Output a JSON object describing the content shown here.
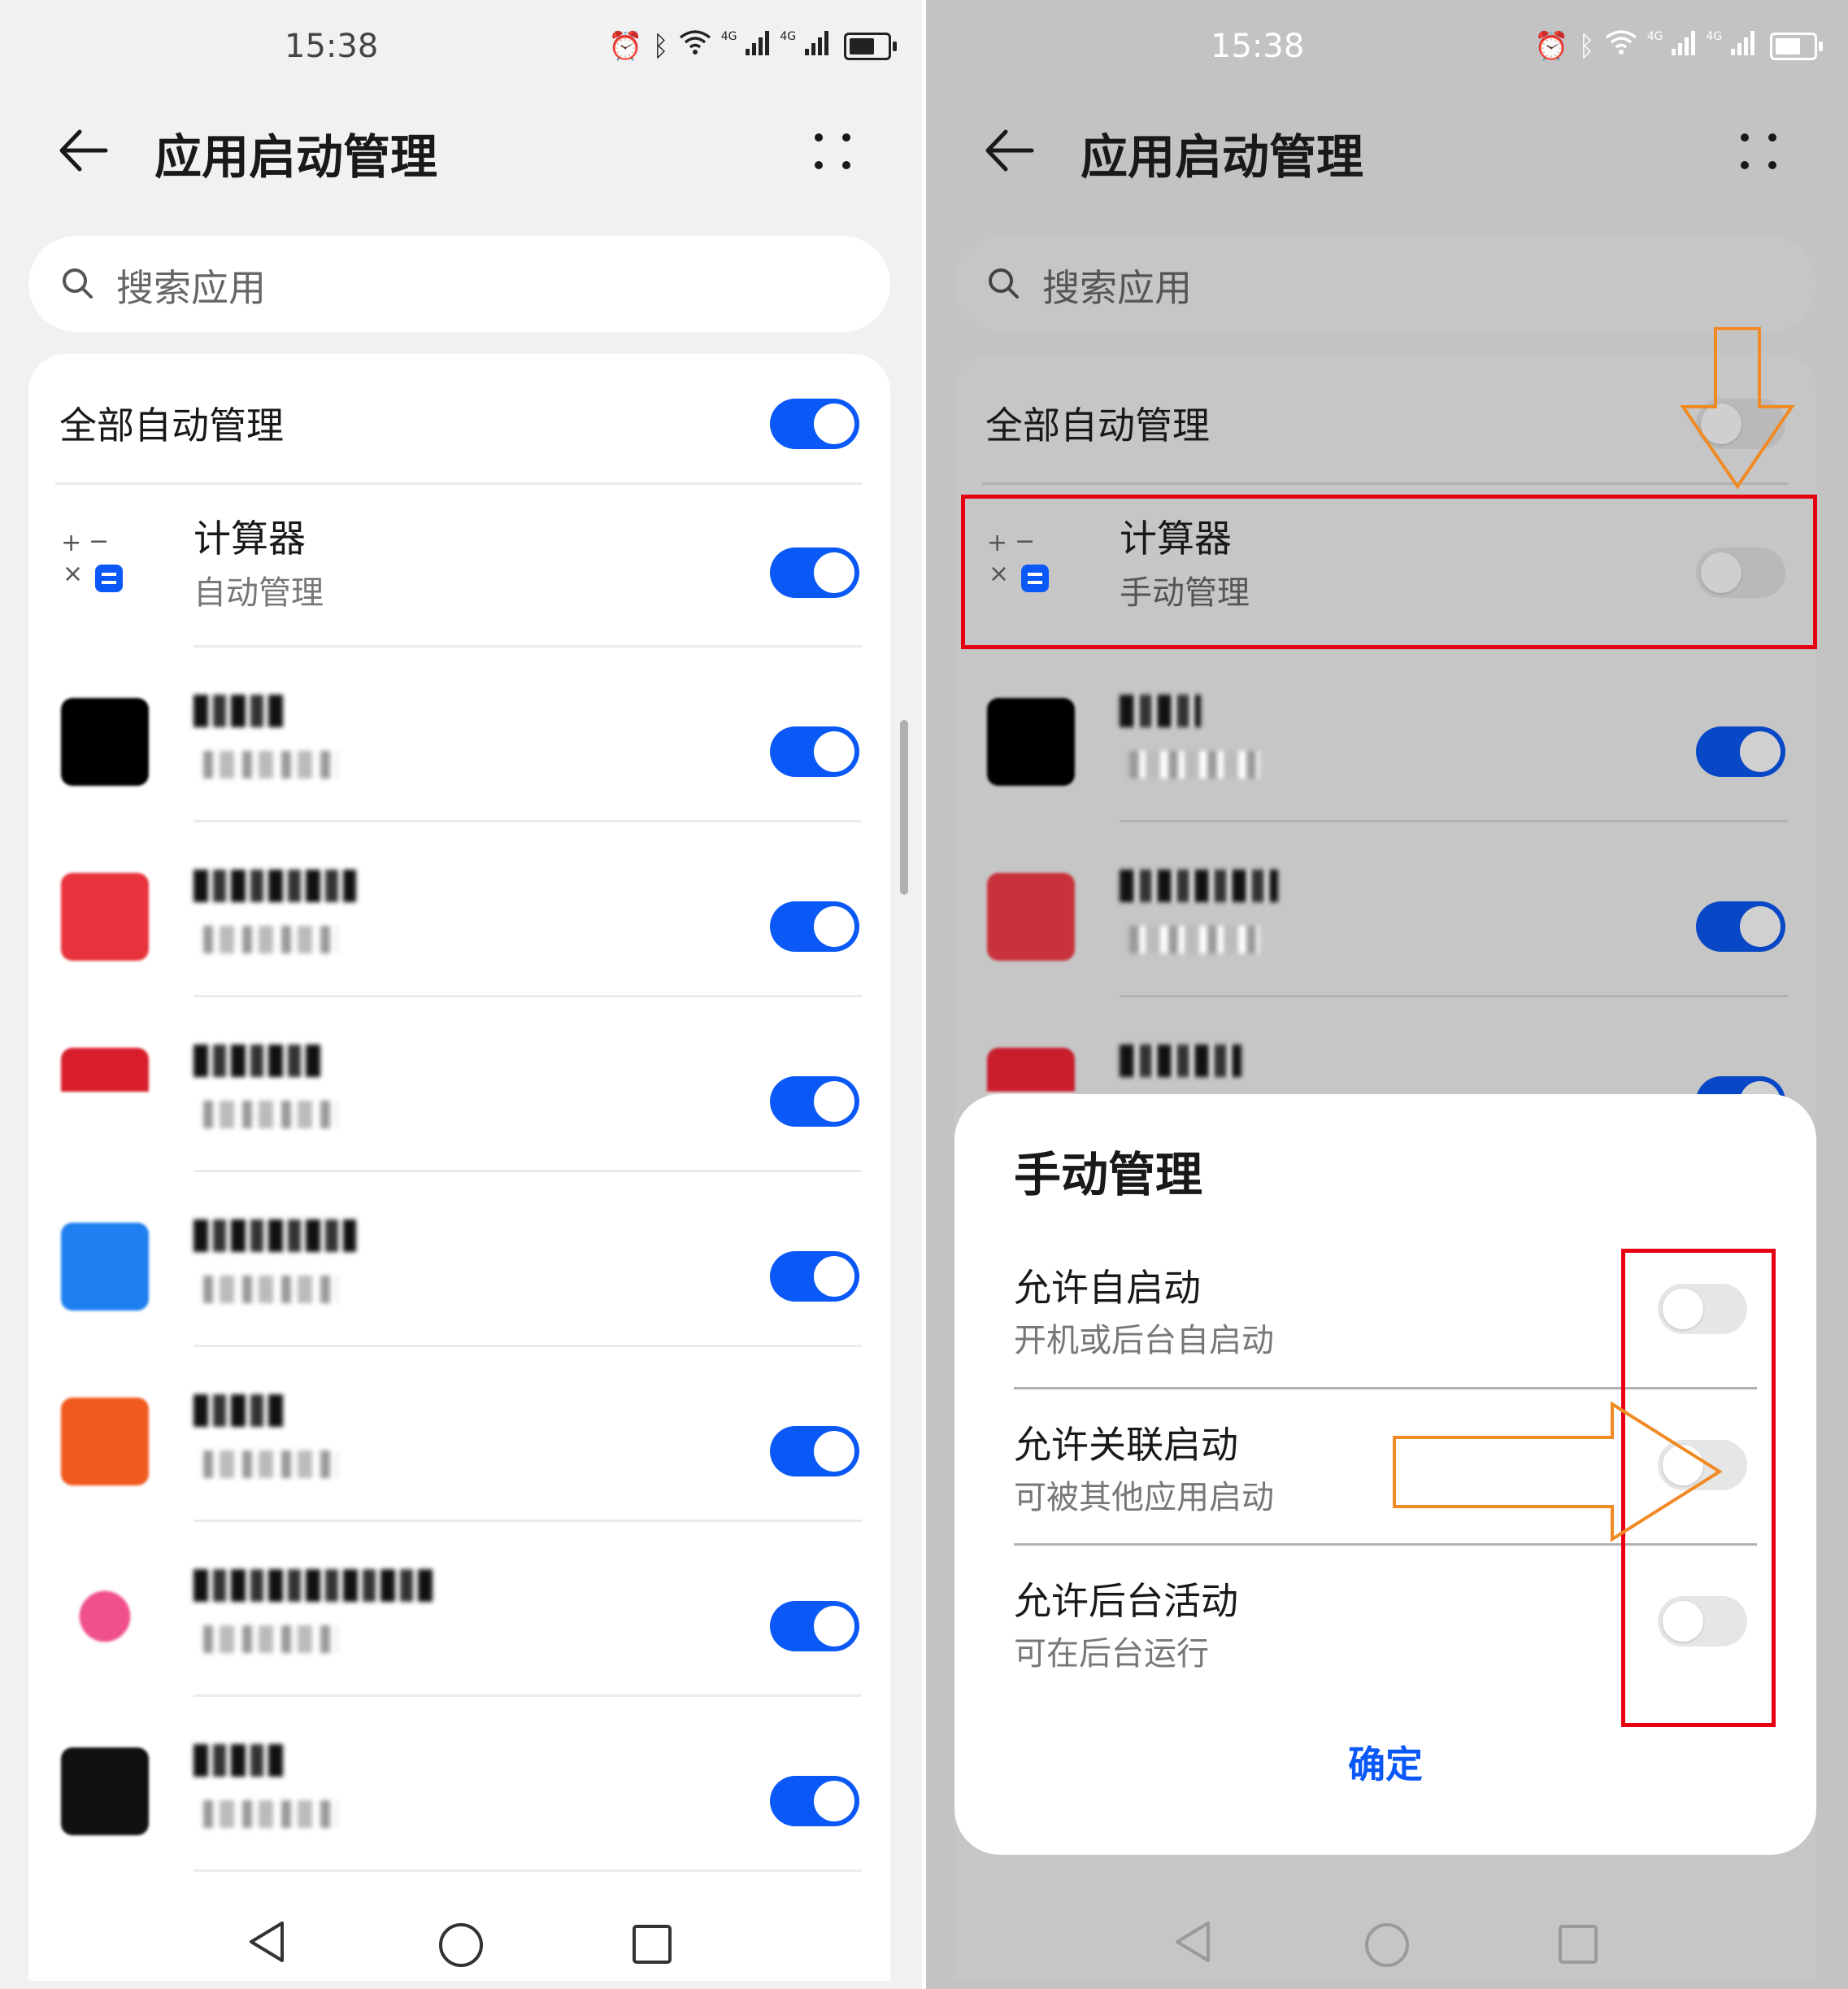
{
  "left": {
    "status": {
      "time": "15:38",
      "network_label": "4G"
    },
    "header": {
      "title": "应用启动管理"
    },
    "search": {
      "placeholder": "搜索应用"
    },
    "all_auto": {
      "label": "全部自动管理",
      "enabled": true
    },
    "apps": [
      {
        "name": "计算器",
        "status": "自动管理",
        "enabled": true,
        "icon": "calculator-icon"
      },
      {
        "name": "",
        "status": "",
        "enabled": true,
        "icon": "blurred-app-icon",
        "color": "#000000"
      },
      {
        "name": "",
        "status": "",
        "enabled": true,
        "icon": "blurred-app-icon",
        "color": "#e8323c"
      },
      {
        "name": "",
        "status": "",
        "enabled": true,
        "icon": "blurred-app-icon",
        "color": "#d81e2c"
      },
      {
        "name": "",
        "status": "",
        "enabled": true,
        "icon": "blurred-app-icon",
        "color": "#1d7ff0"
      },
      {
        "name": "",
        "status": "",
        "enabled": true,
        "icon": "blurred-app-icon",
        "color": "#f05a1e"
      },
      {
        "name": "",
        "status": "",
        "enabled": true,
        "icon": "blurred-app-icon",
        "color": "#f0508c"
      },
      {
        "name": "",
        "status": "",
        "enabled": true,
        "icon": "blurred-app-icon",
        "color": "#111111"
      }
    ]
  },
  "right": {
    "status": {
      "time": "15:38",
      "network_label": "4G"
    },
    "header": {
      "title": "应用启动管理"
    },
    "search": {
      "placeholder": "搜索应用"
    },
    "all_auto": {
      "label": "全部自动管理",
      "enabled": false
    },
    "apps": [
      {
        "name": "计算器",
        "status": "手动管理",
        "enabled": false,
        "icon": "calculator-icon"
      },
      {
        "name": "",
        "status": "",
        "enabled": true,
        "icon": "blurred-app-icon",
        "color": "#000000"
      },
      {
        "name": "",
        "status": "",
        "enabled": true,
        "icon": "blurred-app-icon",
        "color": "#c8323c"
      },
      {
        "name": "",
        "status": "",
        "enabled": true,
        "icon": "blurred-app-icon",
        "color": "#c81e2c"
      }
    ],
    "dialog": {
      "title": "手动管理",
      "options": [
        {
          "label": "允许自启动",
          "desc": "开机或后台自启动",
          "enabled": false
        },
        {
          "label": "允许关联启动",
          "desc": "可被其他应用启动",
          "enabled": false
        },
        {
          "label": "允许后台活动",
          "desc": "可在后台运行",
          "enabled": false
        }
      ],
      "confirm": "确定"
    }
  },
  "colors": {
    "accent": "#0a59f7",
    "highlight_box": "#e60012",
    "arrow": "#f08a24"
  }
}
